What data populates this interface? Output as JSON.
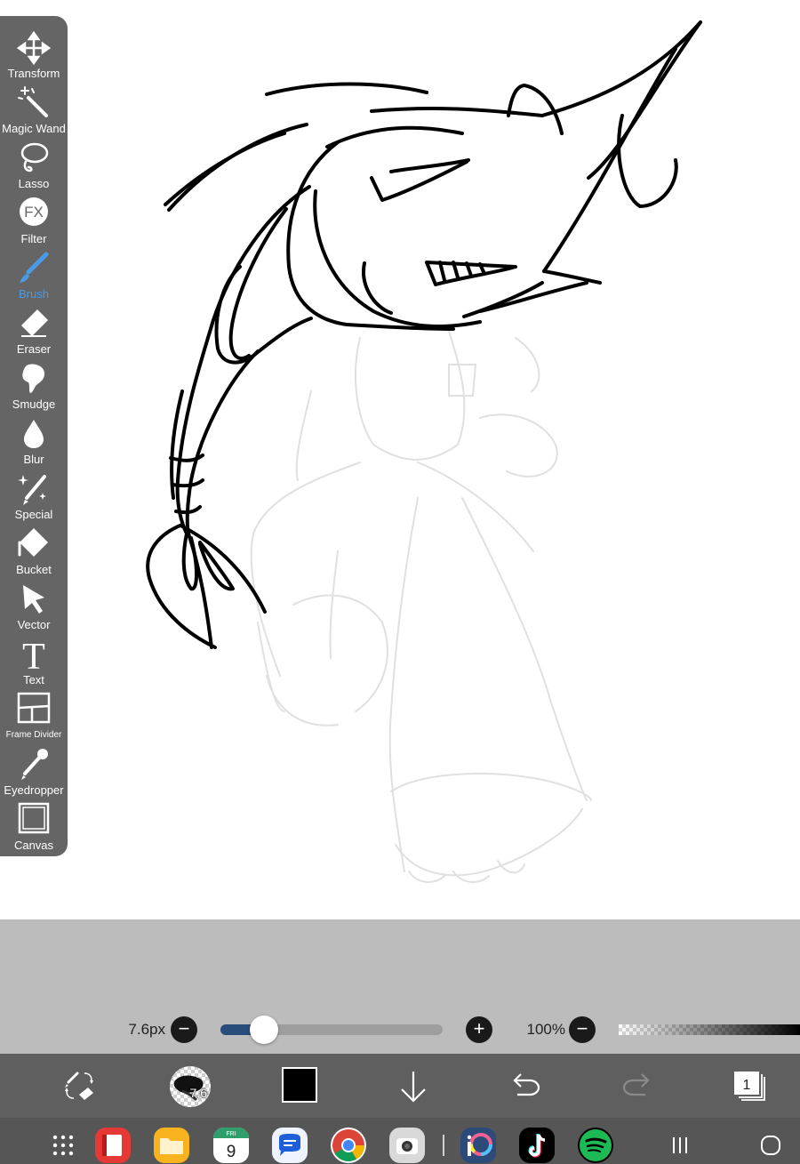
{
  "toolbar": {
    "tools": [
      {
        "label": "Transform"
      },
      {
        "label": "Magic Wand"
      },
      {
        "label": "Lasso"
      },
      {
        "label": "Filter"
      },
      {
        "label": "Brush",
        "active": true
      },
      {
        "label": "Eraser"
      },
      {
        "label": "Smudge"
      },
      {
        "label": "Blur"
      },
      {
        "label": "Special"
      },
      {
        "label": "Bucket"
      },
      {
        "label": "Vector"
      },
      {
        "label": "Text"
      },
      {
        "label": "Frame Divider"
      },
      {
        "label": "Eyedropper"
      },
      {
        "label": "Canvas"
      }
    ],
    "filter_icon_text": "FX",
    "text_icon_glyph": "T",
    "active_color": "#4b9ae8"
  },
  "brush_settings": {
    "size_label": "7.6px",
    "size_fraction": 0.13,
    "minus": "−",
    "plus": "+",
    "opacity_label": "100%",
    "opacity_fraction": 1.0
  },
  "bottom_bar": {
    "brush_size_badge": "7.6",
    "color": "#000000",
    "layer_count": "1"
  },
  "dock": {
    "calendar_day": "FRI",
    "calendar_date": "9"
  }
}
